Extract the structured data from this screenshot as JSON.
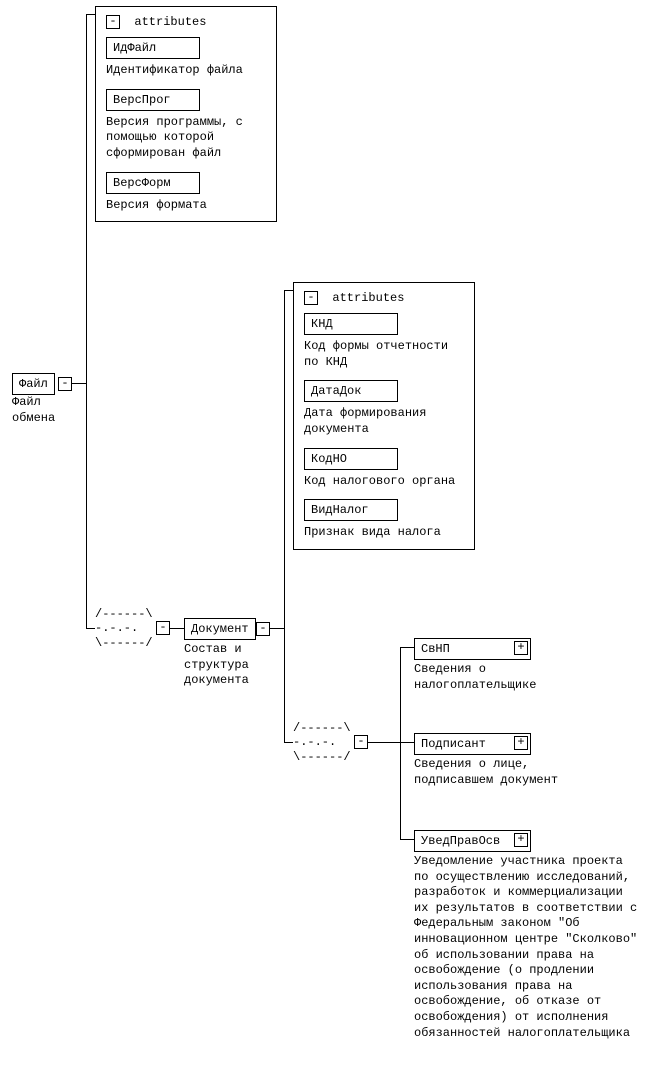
{
  "root": {
    "name": "Файл",
    "desc": "Файл обмена"
  },
  "attr_label": "attributes",
  "minus": "-",
  "plus": "+",
  "seq_art": "/------\\\n-.-.-.\n\\------/",
  "file_attrs": {
    "items": [
      {
        "name": "ИдФайл",
        "desc": "Идентификатор файла"
      },
      {
        "name": "ВерсПрог",
        "desc": "Версия программы, с помощью которой сформирован файл"
      },
      {
        "name": "ВерсФорм",
        "desc": "Версия формата"
      }
    ]
  },
  "document": {
    "name": "Документ",
    "desc": "Состав и структура документа"
  },
  "doc_attrs": {
    "items": [
      {
        "name": "КНД",
        "desc": "Код формы отчетности по КНД"
      },
      {
        "name": "ДатаДок",
        "desc": "Дата формирования документа"
      },
      {
        "name": "КодНО",
        "desc": "Код налогового органа"
      },
      {
        "name": "ВидНалог",
        "desc": "Признак вида налога"
      }
    ]
  },
  "children": [
    {
      "name": "СвНП",
      "desc": "Сведения о налогоплательщике"
    },
    {
      "name": "Подписант",
      "desc": "Сведения о лице, подписавшем документ"
    },
    {
      "name": "УведПравОсв",
      "desc": "Уведомление участника проекта по осуществлению исследований, разработок и коммерциализации их результатов в соответствии с Федеральным законом \"Об инновационном центре \"Сколково\" об использовании права на освобождение (о продлении использования права на освобождение, об отказе от освобождения) от исполнения обязанностей налогоплательщика"
    }
  ]
}
